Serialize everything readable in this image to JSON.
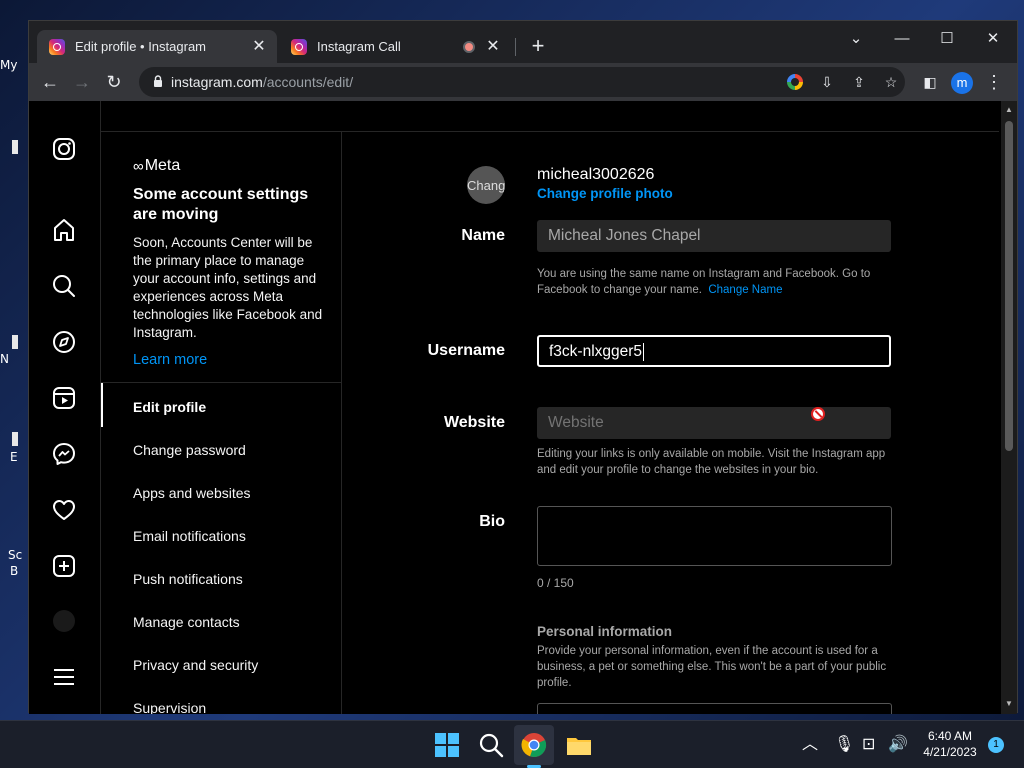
{
  "desktop": {
    "labels": [
      "My",
      "N",
      "E",
      "Sc",
      "B"
    ]
  },
  "browser": {
    "tabs": [
      {
        "title": "Edit profile • Instagram",
        "close": "✕"
      },
      {
        "title": "Instagram Call",
        "close": "✕"
      }
    ],
    "new_tab": "+",
    "window_controls": {
      "minimize": "—",
      "maximize": "☐",
      "close": "✕",
      "dropdown": "⌄"
    },
    "url_host": "instagram.com",
    "url_path": "/accounts/edit/",
    "profile_initial": "m"
  },
  "settings": {
    "meta_brand": "Meta",
    "moving_title": "Some account settings are moving",
    "moving_desc": "Soon, Accounts Center will be the primary place to manage your account info, settings and experiences across Meta technologies like Facebook and Instagram.",
    "learn_more": "Learn more",
    "menu": [
      "Edit profile",
      "Change password",
      "Apps and websites",
      "Email notifications",
      "Push notifications",
      "Manage contacts",
      "Privacy and security",
      "Supervision"
    ]
  },
  "profile": {
    "username": "micheal3002626",
    "pic_alt": "Chang",
    "change_photo": "Change profile photo",
    "name_label": "Name",
    "name_value": "Micheal Jones Chapel",
    "name_help": "You are using the same name on Instagram and Facebook. Go to Facebook to change your name.",
    "change_name": "Change Name",
    "username_label": "Username",
    "username_value": "f3ck-nlxgger5",
    "website_label": "Website",
    "website_placeholder": "Website",
    "website_help": "Editing your links is only available on mobile. Visit the Instagram app and edit your profile to change the websites in your bio.",
    "bio_label": "Bio",
    "bio_counter": "0 / 150",
    "personal_title": "Personal information",
    "personal_help": "Provide your personal information, even if the account is used for a business, a pet or something else. This won't be a part of your public profile."
  },
  "taskbar": {
    "time": "6:40 AM",
    "date": "4/21/2023",
    "notification_count": "1"
  }
}
